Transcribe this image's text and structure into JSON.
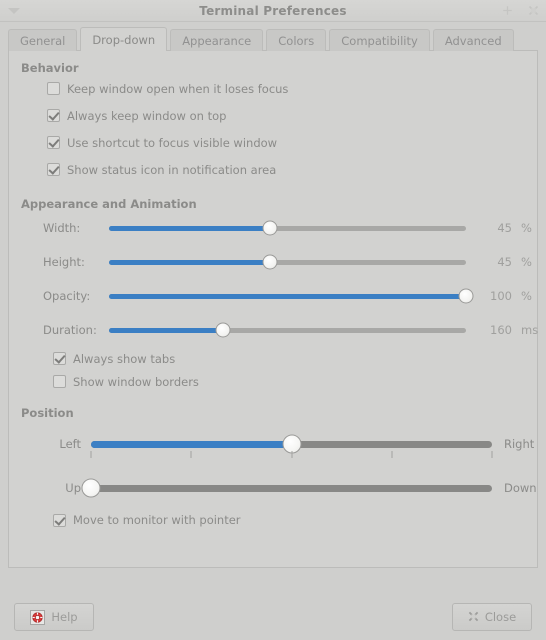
{
  "window": {
    "title": "Terminal Preferences",
    "menu_icon": "triangle-down-icon",
    "minimize_icon": "minimize-icon",
    "close_icon": "window-close-icon"
  },
  "tabs": [
    {
      "label": "General",
      "active": false
    },
    {
      "label": "Drop-down",
      "active": true
    },
    {
      "label": "Appearance",
      "active": false
    },
    {
      "label": "Colors",
      "active": false
    },
    {
      "label": "Compatibility",
      "active": false
    },
    {
      "label": "Advanced",
      "active": false
    }
  ],
  "behavior": {
    "title": "Behavior",
    "options": [
      {
        "label": "Keep window open when it loses focus",
        "checked": false
      },
      {
        "label": "Always keep window on top",
        "checked": true
      },
      {
        "label": "Use shortcut to focus visible window",
        "checked": true
      },
      {
        "label": "Show status icon in notification area",
        "checked": true
      }
    ]
  },
  "appearance": {
    "title": "Appearance and Animation",
    "sliders": [
      {
        "label": "Width:",
        "value": "45",
        "unit": "%",
        "percent": 45
      },
      {
        "label": "Height:",
        "value": "45",
        "unit": "%",
        "percent": 45
      },
      {
        "label": "Opacity:",
        "value": "100",
        "unit": "%",
        "percent": 100
      },
      {
        "label": "Duration:",
        "value": "160",
        "unit": "ms",
        "percent": 32
      }
    ],
    "options": [
      {
        "label": "Always show tabs",
        "checked": true
      },
      {
        "label": "Show window borders",
        "checked": false
      }
    ]
  },
  "position": {
    "title": "Position",
    "horizontal": {
      "left_label": "Left",
      "right_label": "Right",
      "percent": 50,
      "ticks": [
        0,
        25,
        50,
        75,
        100
      ]
    },
    "vertical": {
      "up_label": "Up",
      "down_label": "Down",
      "percent": 0
    },
    "options": [
      {
        "label": "Move to monitor with pointer",
        "checked": true
      }
    ]
  },
  "actions": {
    "help_label": "Help",
    "help_icon": "lifebuoy-help-icon",
    "close_label": "Close",
    "close_icon": "close-x-icon"
  },
  "colors": {
    "accent": "#3b7fc4",
    "track": "#a8a8a6",
    "track_thick": "#888886",
    "background": "#cfcfcd",
    "panel": "#d2d2d0",
    "text": "#8b8b89"
  }
}
